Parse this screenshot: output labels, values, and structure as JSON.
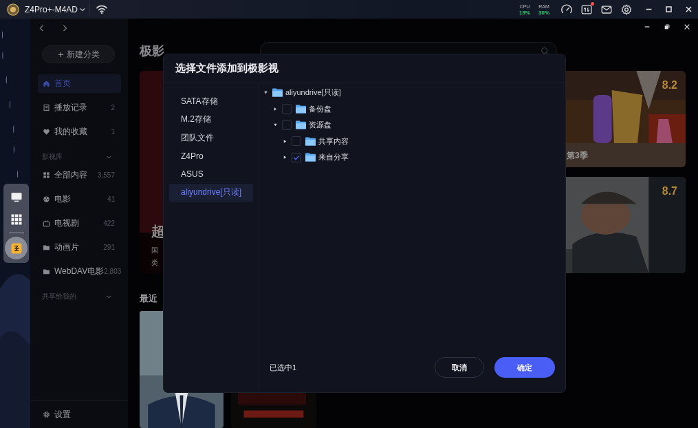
{
  "system_bar": {
    "device_name": "Z4Pro+-M4AD",
    "stats": [
      {
        "label": "CPU",
        "value": "19%"
      },
      {
        "label": "RAM",
        "value": "30%"
      }
    ],
    "notification": true
  },
  "dock": [
    {
      "selected": false
    },
    {
      "selected": false
    },
    {
      "selected": true
    }
  ],
  "sidebar": {
    "new_button": "新建分类",
    "entries": [
      {
        "kind": "item",
        "label": "首页",
        "selected": true
      },
      {
        "kind": "item",
        "label": "播放记录",
        "count": "2",
        "selected": false
      },
      {
        "kind": "item",
        "label": "我的收藏",
        "count": "1",
        "selected": false
      },
      {
        "kind": "section",
        "label": "影视库",
        "expanded": true
      },
      {
        "kind": "item",
        "label": "全部内容",
        "count": "3,557",
        "selected": false
      },
      {
        "kind": "item",
        "label": "电影",
        "count": "41",
        "selected": false
      },
      {
        "kind": "item",
        "label": "电视剧",
        "count": "422",
        "selected": false
      },
      {
        "kind": "item",
        "label": "动画片",
        "count": "291",
        "selected": false
      },
      {
        "kind": "item",
        "label": "WebDAV电影",
        "count": "2,803",
        "selected": false
      },
      {
        "kind": "section",
        "label": "共享给我的",
        "expanded": true
      }
    ],
    "settings": "设置"
  },
  "main": {
    "title": "极影",
    "hero": {
      "title": "超",
      "lines": [
        "国",
        "类"
      ]
    },
    "cards": [
      {
        "rating": "8.2",
        "caption": "第3季"
      },
      {
        "rating": "8.7"
      }
    ],
    "recent_title": "最近"
  },
  "dialog": {
    "title": "选择文件添加到极影视",
    "locations": [
      {
        "label": "SATA存储",
        "selected": false
      },
      {
        "label": "M.2存储",
        "selected": false
      },
      {
        "label": "团队文件",
        "selected": false
      },
      {
        "label": "Z4Pro",
        "selected": false
      },
      {
        "label": "ASUS",
        "selected": false
      },
      {
        "label": "aliyundrive[只读]",
        "selected": true
      }
    ],
    "tree": [
      {
        "kind": "drive",
        "name": "aliyundrive[只读]",
        "expanded": true,
        "children": [
          {
            "kind": "folder",
            "name": "备份盘",
            "expanded": false,
            "checked": false
          },
          {
            "kind": "folder",
            "name": "资源盘",
            "expanded": true,
            "checked": false,
            "children": [
              {
                "kind": "folder",
                "name": "共享内容",
                "expanded": false,
                "checked": false
              },
              {
                "kind": "folder",
                "name": "来自分享",
                "expanded": false,
                "checked": true
              }
            ]
          }
        ]
      }
    ],
    "status": "已选中1",
    "buttons": [
      {
        "label": "取消",
        "kind": "secondary"
      },
      {
        "label": "确定",
        "kind": "primary"
      }
    ]
  }
}
